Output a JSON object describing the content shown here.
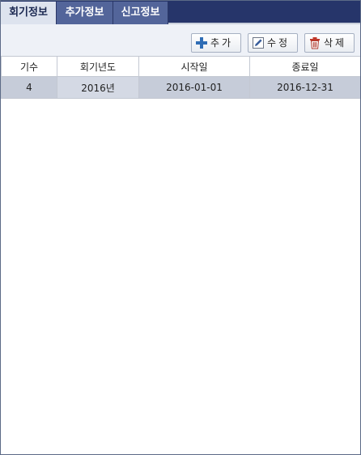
{
  "tabs": [
    {
      "label": "회기정보",
      "active": true
    },
    {
      "label": "추가정보",
      "active": false
    },
    {
      "label": "신고정보",
      "active": false
    }
  ],
  "toolbar": {
    "add_label": "추가",
    "edit_label": "수정",
    "delete_label": "삭제",
    "icons": [
      "plus-icon",
      "pencil-icon",
      "trash-icon"
    ]
  },
  "table": {
    "columns": [
      "기수",
      "회기년도",
      "시작일",
      "종료일"
    ],
    "rows": [
      {
        "term": "4",
        "year": "2016년",
        "start": "2016-01-01",
        "end": "2016-12-31",
        "selected": true
      }
    ]
  },
  "colors": {
    "tabbar_bg": "#26356a",
    "tab_bg": "#53659a",
    "tab_active_bg": "#dde3ee",
    "toolbar_bg": "#eef1f7",
    "selected_row_bg": "#c6ccd9"
  }
}
